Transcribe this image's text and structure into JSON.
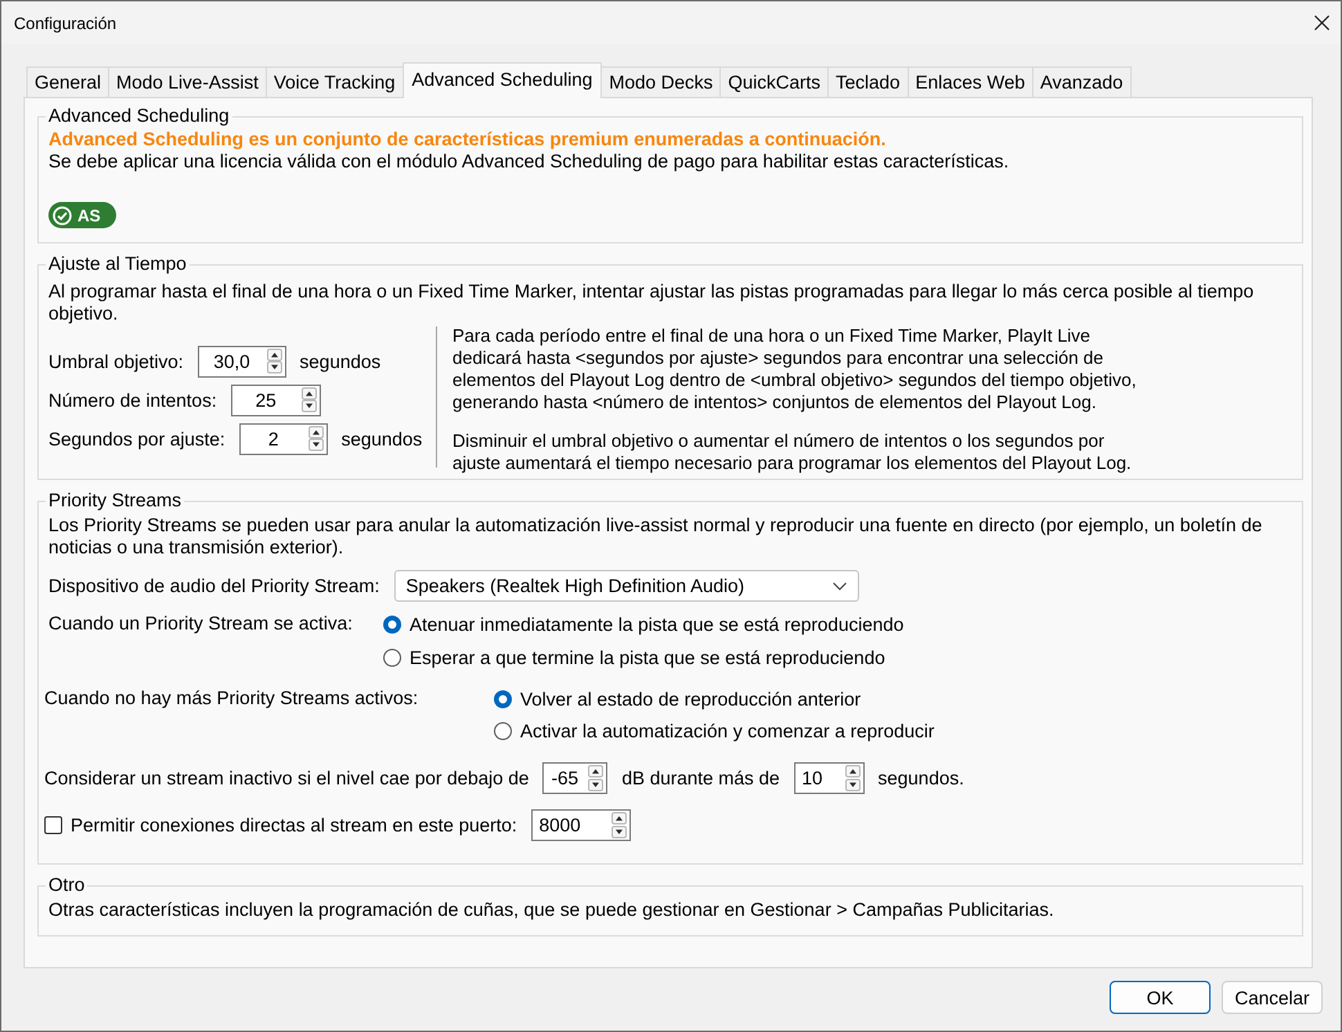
{
  "window": {
    "title": "Configuración"
  },
  "tabs": [
    {
      "label": "General",
      "selected": false
    },
    {
      "label": "Modo Live-Assist",
      "selected": false
    },
    {
      "label": "Voice Tracking",
      "selected": false
    },
    {
      "label": "Advanced Scheduling",
      "selected": true
    },
    {
      "label": "Modo Decks",
      "selected": false
    },
    {
      "label": "QuickCarts",
      "selected": false
    },
    {
      "label": "Teclado",
      "selected": false
    },
    {
      "label": "Enlaces Web",
      "selected": false
    },
    {
      "label": "Avanzado",
      "selected": false
    }
  ],
  "advanced_scheduling": {
    "title": "Advanced Scheduling",
    "headline": "Advanced Scheduling es un conjunto de características premium enumeradas a continuación.",
    "description": "Se debe aplicar una licencia válida con el módulo Advanced Scheduling de pago para habilitar estas características.",
    "badge": "AS"
  },
  "time_adjust": {
    "title": "Ajuste al Tiempo",
    "description": "Al programar hasta el final de una hora o un Fixed Time Marker, intentar ajustar las pistas programadas para llegar lo más cerca posible al tiempo objetivo.",
    "fields": [
      {
        "label": "Umbral objetivo:",
        "value": "30,0",
        "unit": "segundos"
      },
      {
        "label": "Número de intentos:",
        "value": "25"
      },
      {
        "label": "Segundos por ajuste:",
        "value": "2",
        "unit": "segundos"
      }
    ],
    "help": [
      "Para cada período entre el final de una hora o un Fixed Time Marker, PlayIt Live\ndedicará hasta <segundos por ajuste> segundos para encontrar una selección de\nelementos del Playout Log dentro de <umbral objetivo> segundos del tiempo objetivo,\ngenerando hasta <número de intentos> conjuntos de elementos del Playout Log.",
      "Disminuir el umbral objetivo o aumentar el número de intentos o los segundos por\najuste aumentará el tiempo necesario para programar los elementos del Playout Log."
    ]
  },
  "priority_streams": {
    "title": "Priority Streams",
    "description": "Los Priority Streams se pueden usar para anular la automatización live-assist normal y reproducir una fuente en directo (por ejemplo, un boletín de noticias o una transmisión exterior).",
    "device": {
      "label": "Dispositivo de audio del Priority Stream:",
      "value": "Speakers (Realtek High Definition Audio)"
    },
    "radio_groups": [
      {
        "label": "Cuando un Priority Stream se activa:",
        "options": [
          {
            "label": "Atenuar inmediatamente la pista que se está reproduciendo",
            "selected": true
          },
          {
            "label": "Esperar a que termine la pista que se está reproduciendo",
            "selected": false
          }
        ]
      },
      {
        "label": "Cuando no hay más Priority Streams activos:",
        "options": [
          {
            "label": "Volver al estado de reproducción anterior",
            "selected": true
          },
          {
            "label": "Activar la automatización y comenzar a reproducir",
            "selected": false
          }
        ]
      }
    ],
    "inactive_rule": {
      "prefix": "Considerar un stream inactivo si el nivel cae por debajo de",
      "threshold": "-65",
      "middle": "dB durante más de",
      "duration": "10",
      "suffix": "segundos."
    },
    "direct_port": {
      "label": "Permitir conexiones directas al stream en este puerto:",
      "checked": false,
      "value": "8000"
    }
  },
  "other": {
    "title": "Otro",
    "description": "Otras características incluyen la programación de cuñas, que se puede gestionar en Gestionar > Campañas Publicitarias."
  },
  "buttons": [
    {
      "label": "OK",
      "default": true
    },
    {
      "label": "Cancelar",
      "default": false
    }
  ]
}
